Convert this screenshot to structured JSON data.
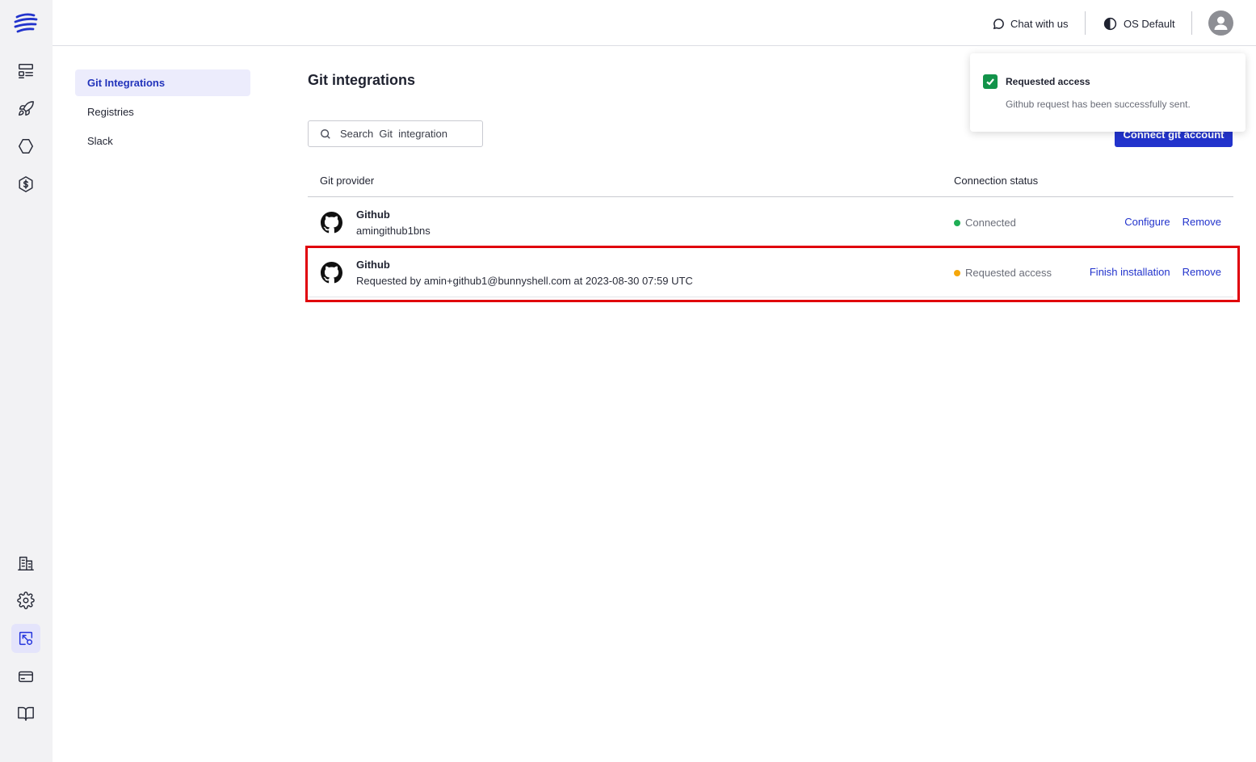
{
  "header": {
    "chat_label": "Chat with us",
    "theme_label": "OS Default"
  },
  "rail": {
    "top_icons": [
      "layout-list-icon",
      "rocket-icon",
      "hexagon-icon",
      "cost-badge-icon"
    ],
    "bottom_icons": [
      "building-icon",
      "gear-icon",
      "integrations-icon",
      "credit-card-icon",
      "book-icon"
    ],
    "active_icon": "integrations-icon"
  },
  "subnav": {
    "items": [
      {
        "label": "Git Integrations",
        "active": true
      },
      {
        "label": "Registries",
        "active": false
      },
      {
        "label": "Slack",
        "active": false
      }
    ]
  },
  "main": {
    "title": "Git integrations",
    "search_placeholder": "Search  Git  integration",
    "connect_button": "Connect git account",
    "columns": {
      "provider": "Git provider",
      "status": "Connection status"
    },
    "rows": [
      {
        "name": "Github",
        "subtitle": "amingithub1bns",
        "status": "Connected",
        "status_color": "#1fae55",
        "actions": [
          "Configure",
          "Remove"
        ]
      },
      {
        "name": "Github",
        "subtitle": "Requested by amin+github1@bunnyshell.com at 2023-08-30 07:59 UTC",
        "status": "Requested access",
        "status_color": "#f5a70a",
        "actions": [
          "Finish installation",
          "Remove"
        ]
      }
    ]
  },
  "toast": {
    "title": "Requested access",
    "message": "Github request has been successfully sent."
  },
  "colors": {
    "accent": "#2233cc",
    "highlight_border": "#e0000b",
    "success": "#12934a"
  }
}
